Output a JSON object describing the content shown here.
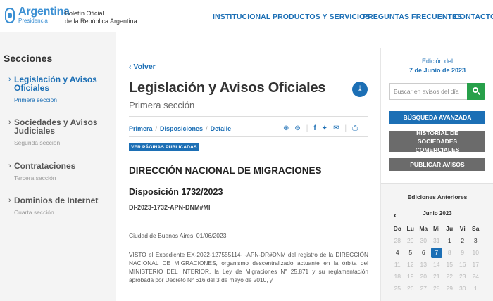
{
  "header": {
    "logo_name": "Argentina",
    "logo_sub": "Presidencia",
    "boletin_line1": "Boletín Oficial",
    "boletin_line2": "de la República Argentina",
    "nav": [
      "INSTITUCIONAL",
      "PRODUCTOS Y SERVICIOS",
      "PREGUNTAS FRECUENTES",
      "CONTACTO"
    ]
  },
  "sidebar": {
    "title": "Secciones",
    "items": [
      {
        "label": "Legislación y Avisos Oficiales",
        "sub": "Primera sección",
        "active": true
      },
      {
        "label": "Sociedades y Avisos Judiciales",
        "sub": "Segunda sección",
        "active": false
      },
      {
        "label": "Contrataciones",
        "sub": "Tercera sección",
        "active": false
      },
      {
        "label": "Dominios de Internet",
        "sub": "Cuarta sección",
        "active": false
      }
    ]
  },
  "main": {
    "back_label": "Volver",
    "title": "Legislación y Avisos Oficiales",
    "subtitle": "Primera sección",
    "breadcrumbs": [
      "Primera",
      "Disposiciones",
      "Detalle"
    ],
    "badge": "VER PÁGINAS PUBLICADAS",
    "organization": "DIRECCIÓN NACIONAL DE MIGRACIONES",
    "disposition": "Disposición 1732/2023",
    "disposition_code": "DI-2023-1732-APN-DNM#MI",
    "place_date": "Ciudad de Buenos Aires, 01/06/2023",
    "body": "VISTO el Expediente EX-2022-127555114- -APN-DR#DNM del registro de la DIRECCIÓN NACIONAL DE MIGRACIONES, organismo descentralizado actuante en la órbita del MINISTERIO DEL INTERIOR, la Ley de Migraciones N° 25.871 y su reglamentación aprobada por Decreto N° 616 del 3 de mayo de 2010, y"
  },
  "right": {
    "edition_label": "Edición del",
    "edition_date": "7 de Junio de 2023",
    "search_placeholder": "Buscar en avisos del día",
    "advanced_search": "BÚSQUEDA AVANZADA",
    "history_btn": "HISTORIAL DE SOCIEDADES COMERCIALES",
    "publish_btn": "PUBLICAR AVISOS",
    "editions_title": "Ediciones Anteriores",
    "calendar": {
      "month": "Junio 2023",
      "weekdays": [
        "Do",
        "Lu",
        "Ma",
        "Mi",
        "Ju",
        "Vi",
        "Sa"
      ],
      "weeks": [
        [
          "28",
          "29",
          "30",
          "31",
          "1",
          "2",
          "3"
        ],
        [
          "4",
          "5",
          "6",
          "7",
          "8",
          "9",
          "10"
        ],
        [
          "11",
          "12",
          "13",
          "14",
          "15",
          "16",
          "17"
        ],
        [
          "18",
          "19",
          "20",
          "21",
          "22",
          "23",
          "24"
        ],
        [
          "25",
          "26",
          "27",
          "28",
          "29",
          "30",
          "1"
        ]
      ],
      "selected": "7"
    }
  },
  "colors": {
    "accent": "#1c6fb5",
    "search_green": "#27a04a",
    "gray_button": "#6b6b6b"
  }
}
